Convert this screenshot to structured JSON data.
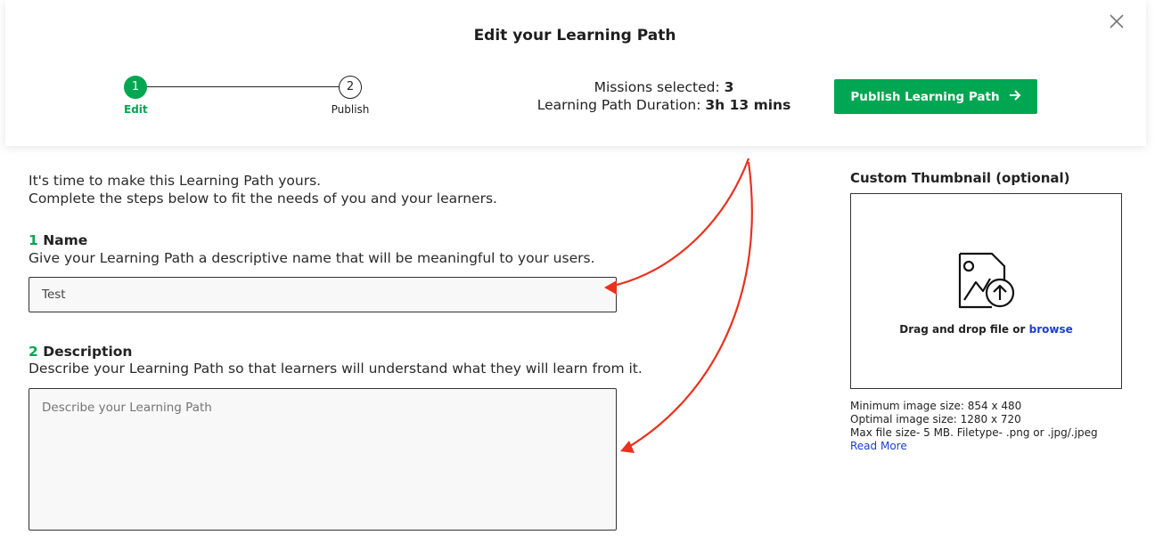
{
  "modal": {
    "title": "Edit your Learning Path",
    "close_icon": "close-icon"
  },
  "stepper": {
    "steps": [
      {
        "number": "1",
        "label": "Edit",
        "active": true
      },
      {
        "number": "2",
        "label": "Publish",
        "active": false
      }
    ]
  },
  "stats": {
    "missions_label": "Missions selected:",
    "missions_value": "3",
    "duration_label": "Learning Path Duration:",
    "duration_value": "3h 13 mins"
  },
  "publish_button": {
    "label": "Publish Learning Path",
    "icon": "arrow-right-icon"
  },
  "intro": {
    "line1": "It's time to make this Learning Path yours.",
    "line2": "Complete the steps below to fit the needs of you and your learners."
  },
  "name_section": {
    "number": "1",
    "title": "Name",
    "description": "Give your Learning Path a descriptive name that will be meaningful to your users.",
    "value": "Test"
  },
  "description_section": {
    "number": "2",
    "title": "Description",
    "description": "Describe your Learning Path so that learners will understand what they will learn from it.",
    "placeholder": "Describe your Learning Path"
  },
  "thumbnail": {
    "title": "Custom Thumbnail (optional)",
    "icon": "image-upload-icon",
    "drop_text": "Drag and drop file or",
    "browse_link": "browse",
    "min_size": "Minimum image size: 854 x 480",
    "optimal_size": "Optimal image size: 1280 x 720",
    "max_file": "Max file size- 5 MB. Filetype- .png or .jpg/.jpeg",
    "read_more": "Read More"
  },
  "colors": {
    "accent_green": "#00a651",
    "link_blue": "#1a3fd1",
    "annotation_red": "#e8321e"
  }
}
